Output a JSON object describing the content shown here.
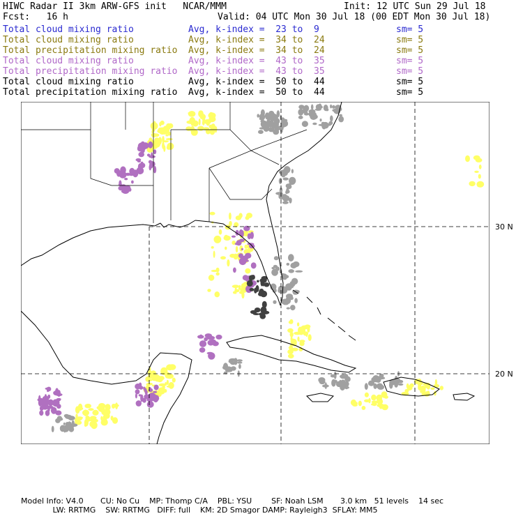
{
  "header": {
    "title": "HIWC Radar II 3km ARW-GFS init   NCAR/MMM",
    "init": "Init: 12 UTC Sun 29 Jul 18",
    "fcst_label": "Fcst:   16 h",
    "valid": "Valid: 04 UTC Mon 30 Jul 18 (00 EDT Mon 30 Jul 18)"
  },
  "fields": [
    {
      "name": "Total cloud mixing ratio",
      "avg": "Avg, k-index =  23 to  9",
      "sm": "sm= 5",
      "color": "#2a2ad0"
    },
    {
      "name": "Total cloud mixing ratio",
      "avg": "Avg, k-index =  34 to  24",
      "sm": "sm= 5",
      "color": "#8a7a10"
    },
    {
      "name": "Total precipitation mixing ratio",
      "avg": "Avg, k-index =  34 to  24",
      "sm": "sm= 5",
      "color": "#8a7a10"
    },
    {
      "name": "Total cloud mixing ratio",
      "avg": "Avg, k-index =  43 to  35",
      "sm": "sm= 5",
      "color": "#b068c8"
    },
    {
      "name": "Total precipitation mixing ratio",
      "avg": "Avg, k-index =  43 to  35",
      "sm": "sm= 5",
      "color": "#b068c8"
    },
    {
      "name": "Total cloud mixing ratio",
      "avg": "Avg, k-index =  50 to  44",
      "sm": "sm= 5",
      "color": "#000000"
    },
    {
      "name": "Total precipitation mixing ratio",
      "avg": "Avg, k-index =  50 to  44",
      "sm": "sm= 5",
      "color": "#000000"
    }
  ],
  "map": {
    "lat_labels": [
      "30 N",
      "20 N"
    ],
    "colors": {
      "yellow": "#ffff66",
      "violet": "#b070c0",
      "gray": "#a0a0a0",
      "dark": "#404040",
      "cyan": "#d8f4f8"
    }
  },
  "footer": {
    "line1": "Model Info: V4.0       CU: No Cu    MP: Thomp C/A    PBL: YSU        SF: Noah LSM       3.0 km   51 levels    14 sec",
    "line2": "             LW: RRTMG    SW: RRTMG   DIFF: full    KM: 2D Smagor DAMP: Rayleigh3  SFLAY: MM5"
  }
}
